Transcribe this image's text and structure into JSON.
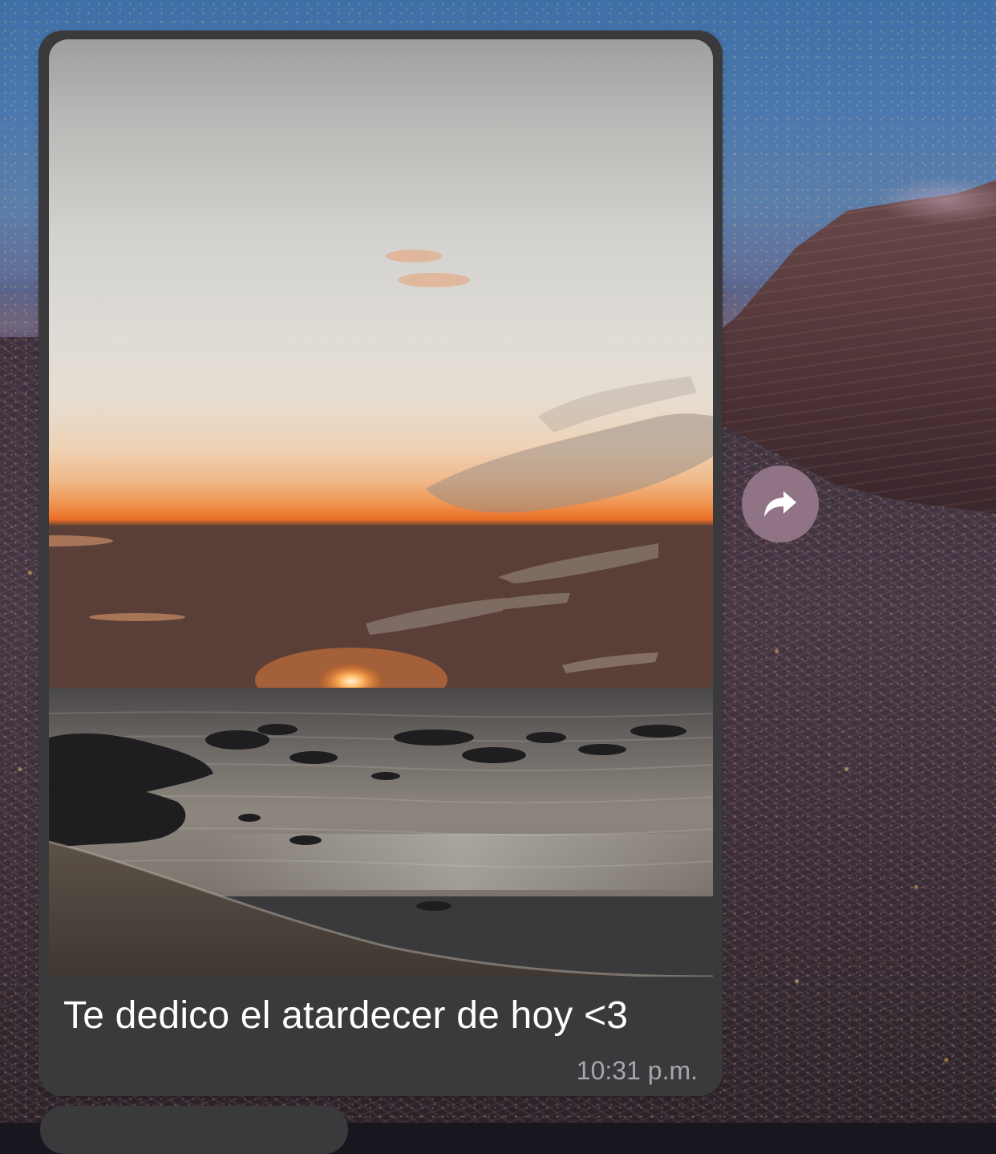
{
  "message": {
    "caption": "Te dedico el atardecer de hoy <3",
    "time": "10:31 p.m."
  },
  "icons": {
    "forward": "forward-arrow-icon"
  },
  "colors": {
    "bubble_bg": "#3a3a3c",
    "caption_text": "#ffffff",
    "time_text": "#a7a7ab",
    "forward_button_bg": "#96788a"
  }
}
